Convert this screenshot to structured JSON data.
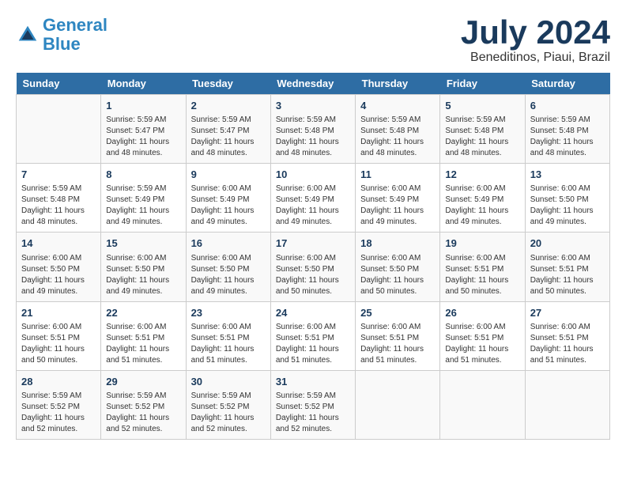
{
  "logo": {
    "line1": "General",
    "line2": "Blue"
  },
  "title": "July 2024",
  "location": "Beneditinos, Piaui, Brazil",
  "days_of_week": [
    "Sunday",
    "Monday",
    "Tuesday",
    "Wednesday",
    "Thursday",
    "Friday",
    "Saturday"
  ],
  "weeks": [
    [
      {
        "day": "",
        "info": ""
      },
      {
        "day": "1",
        "info": "Sunrise: 5:59 AM\nSunset: 5:47 PM\nDaylight: 11 hours\nand 48 minutes."
      },
      {
        "day": "2",
        "info": "Sunrise: 5:59 AM\nSunset: 5:47 PM\nDaylight: 11 hours\nand 48 minutes."
      },
      {
        "day": "3",
        "info": "Sunrise: 5:59 AM\nSunset: 5:48 PM\nDaylight: 11 hours\nand 48 minutes."
      },
      {
        "day": "4",
        "info": "Sunrise: 5:59 AM\nSunset: 5:48 PM\nDaylight: 11 hours\nand 48 minutes."
      },
      {
        "day": "5",
        "info": "Sunrise: 5:59 AM\nSunset: 5:48 PM\nDaylight: 11 hours\nand 48 minutes."
      },
      {
        "day": "6",
        "info": "Sunrise: 5:59 AM\nSunset: 5:48 PM\nDaylight: 11 hours\nand 48 minutes."
      }
    ],
    [
      {
        "day": "7",
        "info": "Sunrise: 5:59 AM\nSunset: 5:48 PM\nDaylight: 11 hours\nand 48 minutes."
      },
      {
        "day": "8",
        "info": "Sunrise: 5:59 AM\nSunset: 5:49 PM\nDaylight: 11 hours\nand 49 minutes."
      },
      {
        "day": "9",
        "info": "Sunrise: 6:00 AM\nSunset: 5:49 PM\nDaylight: 11 hours\nand 49 minutes."
      },
      {
        "day": "10",
        "info": "Sunrise: 6:00 AM\nSunset: 5:49 PM\nDaylight: 11 hours\nand 49 minutes."
      },
      {
        "day": "11",
        "info": "Sunrise: 6:00 AM\nSunset: 5:49 PM\nDaylight: 11 hours\nand 49 minutes."
      },
      {
        "day": "12",
        "info": "Sunrise: 6:00 AM\nSunset: 5:49 PM\nDaylight: 11 hours\nand 49 minutes."
      },
      {
        "day": "13",
        "info": "Sunrise: 6:00 AM\nSunset: 5:50 PM\nDaylight: 11 hours\nand 49 minutes."
      }
    ],
    [
      {
        "day": "14",
        "info": "Sunrise: 6:00 AM\nSunset: 5:50 PM\nDaylight: 11 hours\nand 49 minutes."
      },
      {
        "day": "15",
        "info": "Sunrise: 6:00 AM\nSunset: 5:50 PM\nDaylight: 11 hours\nand 49 minutes."
      },
      {
        "day": "16",
        "info": "Sunrise: 6:00 AM\nSunset: 5:50 PM\nDaylight: 11 hours\nand 49 minutes."
      },
      {
        "day": "17",
        "info": "Sunrise: 6:00 AM\nSunset: 5:50 PM\nDaylight: 11 hours\nand 50 minutes."
      },
      {
        "day": "18",
        "info": "Sunrise: 6:00 AM\nSunset: 5:50 PM\nDaylight: 11 hours\nand 50 minutes."
      },
      {
        "day": "19",
        "info": "Sunrise: 6:00 AM\nSunset: 5:51 PM\nDaylight: 11 hours\nand 50 minutes."
      },
      {
        "day": "20",
        "info": "Sunrise: 6:00 AM\nSunset: 5:51 PM\nDaylight: 11 hours\nand 50 minutes."
      }
    ],
    [
      {
        "day": "21",
        "info": "Sunrise: 6:00 AM\nSunset: 5:51 PM\nDaylight: 11 hours\nand 50 minutes."
      },
      {
        "day": "22",
        "info": "Sunrise: 6:00 AM\nSunset: 5:51 PM\nDaylight: 11 hours\nand 51 minutes."
      },
      {
        "day": "23",
        "info": "Sunrise: 6:00 AM\nSunset: 5:51 PM\nDaylight: 11 hours\nand 51 minutes."
      },
      {
        "day": "24",
        "info": "Sunrise: 6:00 AM\nSunset: 5:51 PM\nDaylight: 11 hours\nand 51 minutes."
      },
      {
        "day": "25",
        "info": "Sunrise: 6:00 AM\nSunset: 5:51 PM\nDaylight: 11 hours\nand 51 minutes."
      },
      {
        "day": "26",
        "info": "Sunrise: 6:00 AM\nSunset: 5:51 PM\nDaylight: 11 hours\nand 51 minutes."
      },
      {
        "day": "27",
        "info": "Sunrise: 6:00 AM\nSunset: 5:51 PM\nDaylight: 11 hours\nand 51 minutes."
      }
    ],
    [
      {
        "day": "28",
        "info": "Sunrise: 5:59 AM\nSunset: 5:52 PM\nDaylight: 11 hours\nand 52 minutes."
      },
      {
        "day": "29",
        "info": "Sunrise: 5:59 AM\nSunset: 5:52 PM\nDaylight: 11 hours\nand 52 minutes."
      },
      {
        "day": "30",
        "info": "Sunrise: 5:59 AM\nSunset: 5:52 PM\nDaylight: 11 hours\nand 52 minutes."
      },
      {
        "day": "31",
        "info": "Sunrise: 5:59 AM\nSunset: 5:52 PM\nDaylight: 11 hours\nand 52 minutes."
      },
      {
        "day": "",
        "info": ""
      },
      {
        "day": "",
        "info": ""
      },
      {
        "day": "",
        "info": ""
      }
    ]
  ]
}
